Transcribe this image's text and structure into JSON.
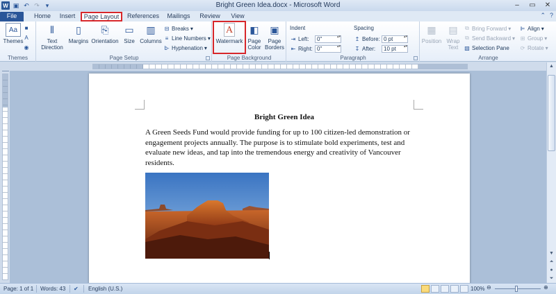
{
  "window": {
    "title": "Bright Green Idea.docx - Microsoft Word",
    "qat": [
      "word-icon",
      "save-icon",
      "undo-icon",
      "redo-icon",
      "customize-icon"
    ]
  },
  "tabs": [
    {
      "label": "File"
    },
    {
      "label": "Home"
    },
    {
      "label": "Insert"
    },
    {
      "label": "Page Layout"
    },
    {
      "label": "References"
    },
    {
      "label": "Mailings"
    },
    {
      "label": "Review"
    },
    {
      "label": "View"
    }
  ],
  "ribbon": {
    "themes": {
      "label": "Themes",
      "group": "Themes"
    },
    "page_setup": {
      "group": "Page Setup",
      "text_direction": "Text Direction",
      "margins": "Margins",
      "orientation": "Orientation",
      "size": "Size",
      "columns": "Columns",
      "breaks": "Breaks",
      "line_numbers": "Line Numbers",
      "hyphenation": "Hyphenation"
    },
    "page_background": {
      "group": "Page Background",
      "watermark": "Watermark",
      "page_color": "Page Color",
      "page_borders": "Page Borders"
    },
    "paragraph": {
      "group": "Paragraph",
      "indent": "Indent",
      "left_label": "Left:",
      "left_value": "0\"",
      "right_label": "Right:",
      "right_value": "0\"",
      "spacing": "Spacing",
      "before_label": "Before:",
      "before_value": "0 pt",
      "after_label": "After:",
      "after_value": "10 pt"
    },
    "arrange": {
      "group": "Arrange",
      "position": "Position",
      "wrap_text": "Wrap Text",
      "bring_forward": "Bring Forward",
      "send_backward": "Send Backward",
      "selection_pane": "Selection Pane",
      "align": "Align",
      "group_btn": "Group",
      "rotate": "Rotate"
    }
  },
  "document": {
    "title": "Bright Green Idea",
    "body": "A Green Seeds Fund would provide funding for up to 100 citizen-led demonstration or engagement projects annually. The purpose is to stimulate bold experiments, test and evaluate new ideas, and tap into the tremendous energy and creativity of Vancouver residents."
  },
  "status": {
    "page": "Page: 1 of 1",
    "words": "Words: 43",
    "language": "English (U.S.)",
    "zoom": "100%"
  },
  "colors": {
    "accent": "#2b579a",
    "highlight": "#d7262a"
  }
}
